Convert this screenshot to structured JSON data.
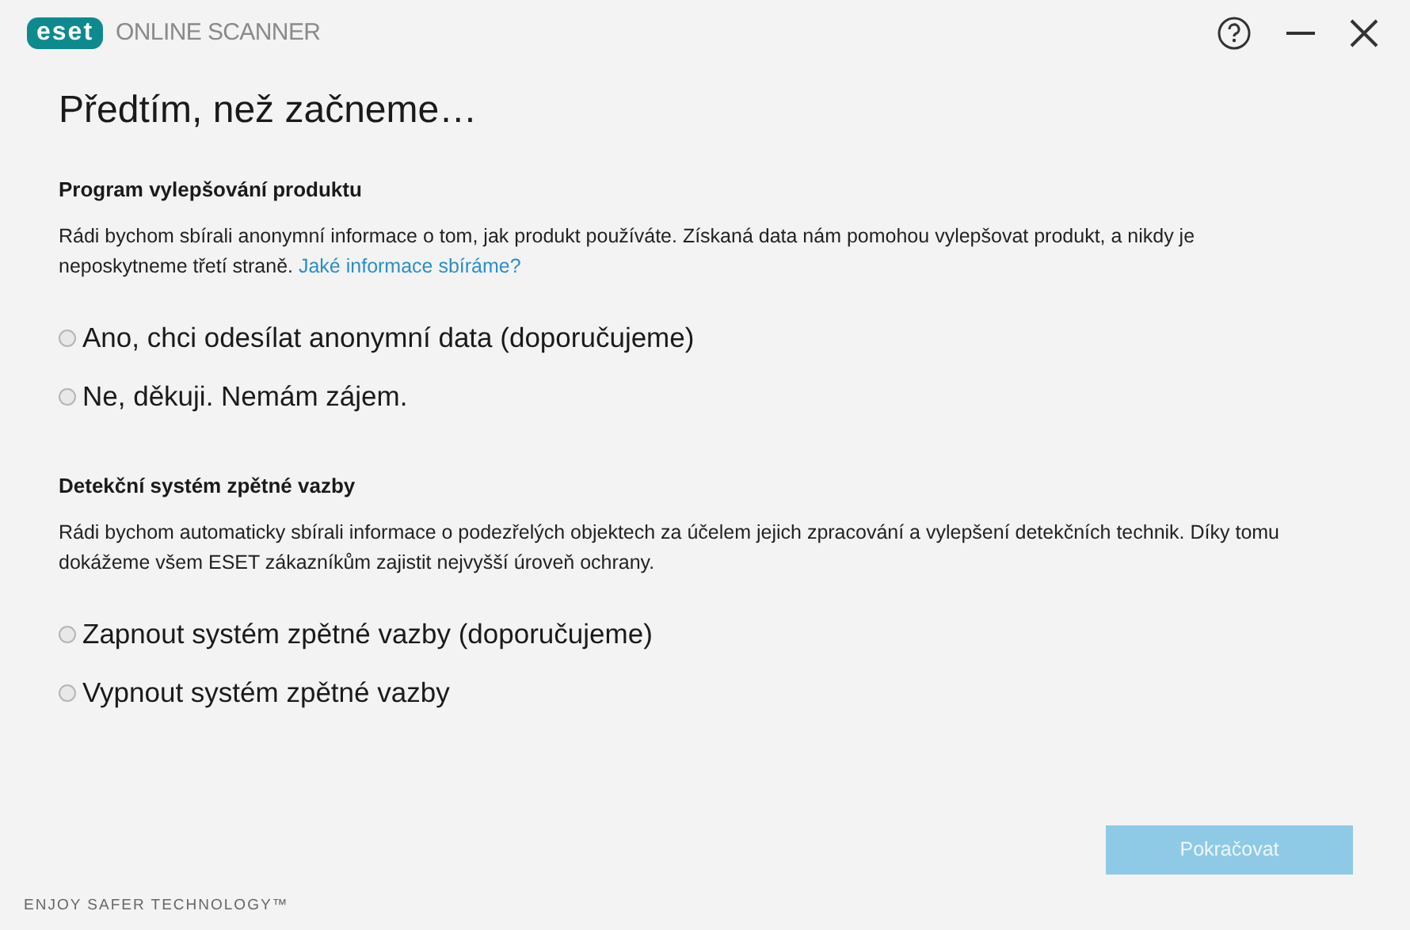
{
  "header": {
    "logo_text": "eset",
    "product": "ONLINE SCANNER"
  },
  "title": "Předtím, než začneme…",
  "sections": [
    {
      "heading": "Program vylepšování produktu",
      "text": "Rádi bychom sbírali anonymní informace o tom, jak produkt používáte. Získaná data nám pomohou vylepšovat produkt, a nikdy je neposkytneme třetí straně.",
      "link": "Jaké informace sbíráme?",
      "options": [
        {
          "label": "Ano, chci odesílat anonymní data (doporučujeme)",
          "selected": false
        },
        {
          "label": "Ne, děkuji. Nemám zájem.",
          "selected": false
        }
      ]
    },
    {
      "heading": "Detekční systém zpětné vazby",
      "text": "Rádi bychom automaticky sbírali informace o podezřelých objektech za účelem jejich zpracování a vylepšení detekčních technik. Díky tomu dokážeme všem ESET zákazníkům zajistit nejvyšší úroveň ochrany.",
      "options": [
        {
          "label": "Zapnout systém zpětné vazby (doporučujeme)",
          "selected": false
        },
        {
          "label": "Vypnout systém zpětné vazby",
          "selected": false
        }
      ]
    }
  ],
  "continue_button": {
    "label": "Pokračovat",
    "disabled": true
  },
  "footer": "ENJOY SAFER TECHNOLOGY™"
}
